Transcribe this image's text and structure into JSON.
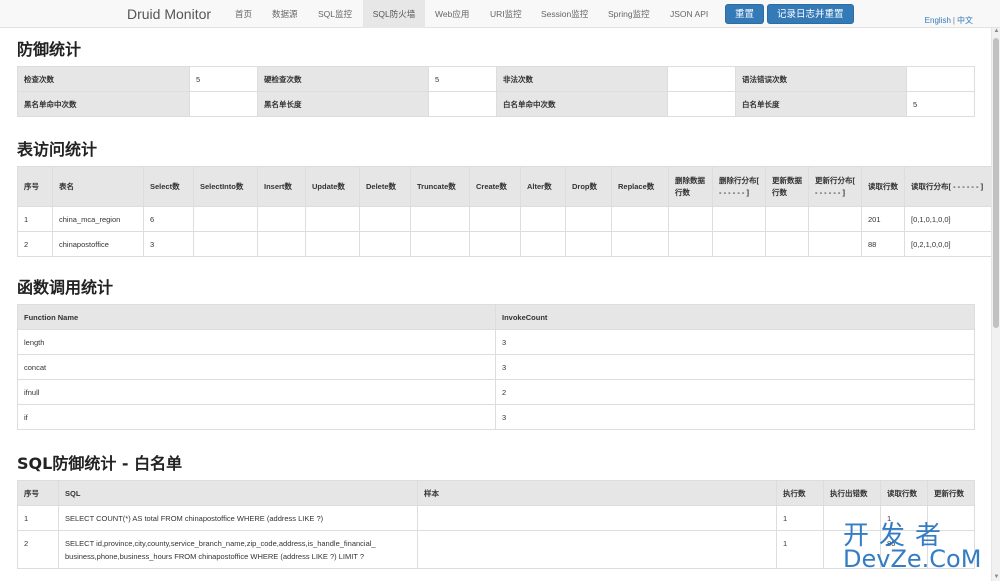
{
  "nav": {
    "brand": "Druid Monitor",
    "items": [
      "首页",
      "数据源",
      "SQL监控",
      "SQL防火墙",
      "Web应用",
      "URI监控",
      "Session监控",
      "Spring监控",
      "JSON API"
    ],
    "active_index": 3,
    "reset_button": "重置",
    "log_reset_button": "记录日志并重置",
    "lang_en": "English",
    "lang_sep": "|",
    "lang_cn": "中文"
  },
  "defense": {
    "title": "防御统计",
    "rows": [
      [
        [
          "检查次数",
          "5"
        ],
        [
          "硬检查次数",
          "5"
        ],
        [
          "非法次数",
          ""
        ],
        [
          "语法错误次数",
          ""
        ]
      ],
      [
        [
          "黑名单命中次数",
          ""
        ],
        [
          "黑名单长度",
          ""
        ],
        [
          "白名单命中次数",
          ""
        ],
        [
          "白名单长度",
          "5"
        ]
      ]
    ]
  },
  "table_access": {
    "title": "表访问统计",
    "headers": [
      "序号",
      "表名",
      "Select数",
      "SelectInto数",
      "Insert数",
      "Update数",
      "Delete数",
      "Truncate数",
      "Create数",
      "Alter数",
      "Drop数",
      "Replace数",
      "删除数据行数",
      "删除行分布[ - - - - - - ]",
      "更新数据行数",
      "更新行分布[ - - - - - - ]",
      "读取行数",
      "读取行分布[ - - - - - - ]"
    ],
    "rows": [
      [
        "1",
        "china_mca_region",
        "6",
        "",
        "",
        "",
        "",
        "",
        "",
        "",
        "",
        "",
        "",
        "",
        "",
        "",
        "201",
        "[0,1,0,1,0,0]"
      ],
      [
        "2",
        "chinapostoffice",
        "3",
        "",
        "",
        "",
        "",
        "",
        "",
        "",
        "",
        "",
        "",
        "",
        "",
        "",
        "88",
        "[0,2,1,0,0,0]"
      ]
    ]
  },
  "functions": {
    "title": "函数调用统计",
    "headers": [
      "Function Name",
      "InvokeCount"
    ],
    "rows": [
      [
        "length",
        "3"
      ],
      [
        "concat",
        "3"
      ],
      [
        "ifnull",
        "2"
      ],
      [
        "if",
        "3"
      ]
    ]
  },
  "sql_whitelist": {
    "title": "SQL防御统计 - 白名单",
    "headers": [
      "序号",
      "SQL",
      "样本",
      "执行数",
      "执行出错数",
      "读取行数",
      "更新行数"
    ],
    "rows": [
      [
        "1",
        "SELECT COUNT(*) AS total FROM chinapostoffice WHERE (address LIKE ?)",
        "",
        "1",
        "",
        "1",
        ""
      ],
      [
        "2",
        "SELECT id,province,city,county,service_branch_name,zip_code,address,is_handle_financial_ business,phone,business_hours FROM chinapostoffice WHERE (address LIKE ?) LIMIT ?",
        "",
        "1",
        "",
        "86",
        ""
      ]
    ]
  },
  "watermark": {
    "cn": "开发者",
    "en": "DevZe.CoM"
  },
  "icons": {
    "scroll_up": "arrow-up-icon",
    "scroll_down": "arrow-down-icon"
  }
}
